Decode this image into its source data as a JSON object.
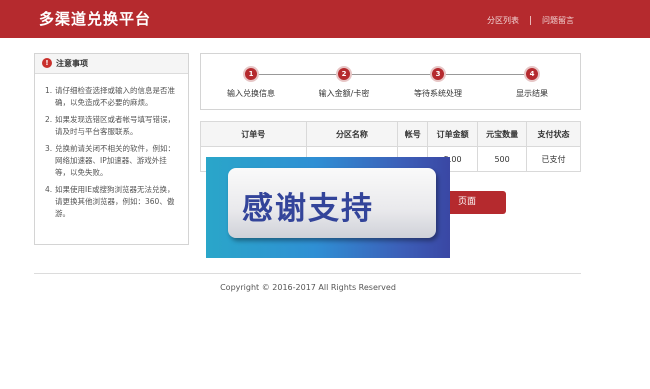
{
  "header": {
    "brand": "多渠道兑换平台",
    "nav": [
      "分区列表",
      "问题留言"
    ]
  },
  "notice": {
    "title": "注意事项",
    "icon": "warning-icon",
    "items": [
      {
        "num": "1.",
        "text": "请仔细检查选择或输入的信息是否准确，以免造成不必要的麻烦。"
      },
      {
        "num": "2.",
        "text": "如果发现选错区或者帐号填写错误，请及时与平台客服联系。"
      },
      {
        "num": "3.",
        "text": "兑换前请关闭不相关的软件，例如：网络加速器、IP加速器、游戏外挂等，以免失败。"
      },
      {
        "num": "4.",
        "text": "如果使用IE或搜狗浏览器无法兑换，请更换其他浏览器，例如：360、傲游。"
      }
    ]
  },
  "steps": [
    {
      "num": "1",
      "label": "输入兑换信息"
    },
    {
      "num": "2",
      "label": "输入金额/卡密"
    },
    {
      "num": "3",
      "label": "等待系统处理"
    },
    {
      "num": "4",
      "label": "显示结果"
    }
  ],
  "table": {
    "headers": [
      "订单号",
      "分区名称",
      "帐号",
      "订单金额",
      "元宝数量",
      "支付状态"
    ],
    "row": [
      "",
      "",
      "",
      "5.00",
      "500",
      "已支付"
    ]
  },
  "back_button": "页面",
  "overlay_text": "感谢支持",
  "footer": "Copyright © 2016-2017 All Rights Reserved",
  "colors": {
    "brand": "#b52a2e",
    "overlay": "#2f8fd4"
  }
}
